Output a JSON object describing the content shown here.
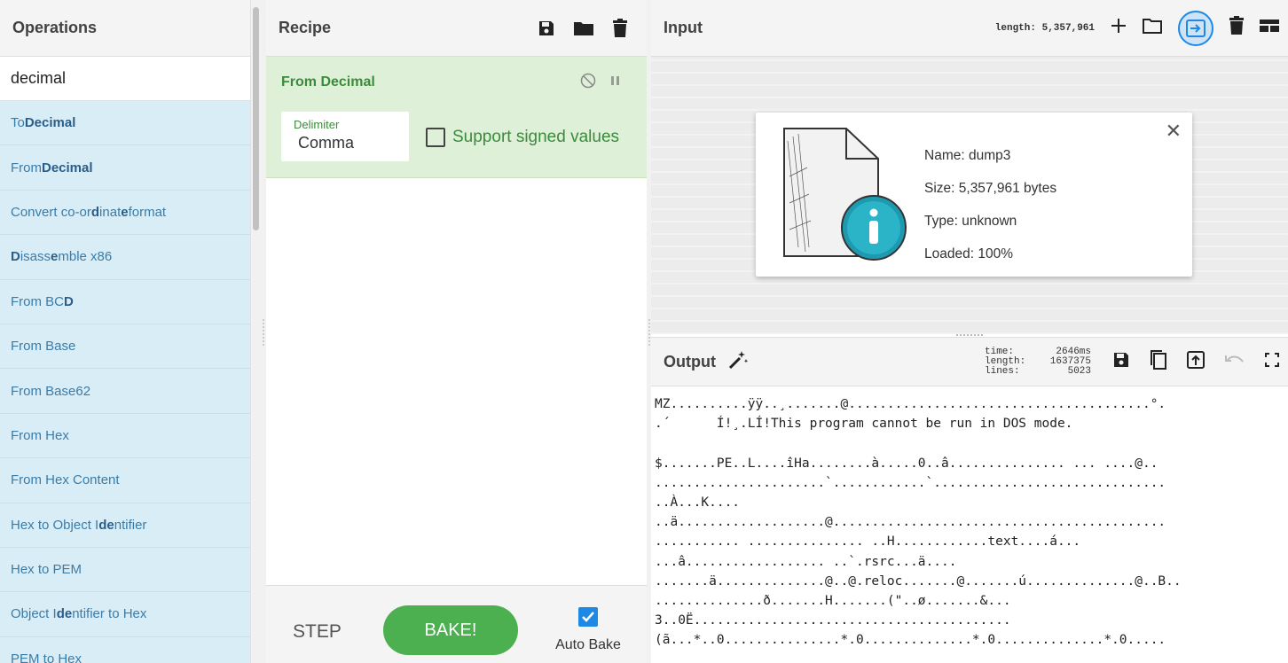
{
  "operations": {
    "title": "Operations",
    "search_value": "decimal",
    "items": [
      {
        "pre": "To ",
        "hl": "Decimal",
        "post": ""
      },
      {
        "pre": "From ",
        "hl": "Decimal",
        "post": ""
      },
      {
        "pre": "Convert co-or",
        "hl": "d",
        "mid": "inat",
        "hl2": "e",
        "post": " format"
      },
      {
        "pre": "",
        "hl": "D",
        "mid": "isass",
        "hl2": "e",
        "post": "mble x86"
      },
      {
        "pre": "From BC",
        "hl": "D",
        "post": ""
      },
      {
        "pre": "From Base",
        "hl": "",
        "post": ""
      },
      {
        "pre": "From Base62",
        "hl": "",
        "post": ""
      },
      {
        "pre": "From Hex",
        "hl": "",
        "post": ""
      },
      {
        "pre": "From Hex Content",
        "hl": "",
        "post": ""
      },
      {
        "pre": "Hex to Object I",
        "hl": "de",
        "post": "ntifier"
      },
      {
        "pre": "Hex to PEM",
        "hl": "",
        "post": ""
      },
      {
        "pre": "Object I",
        "hl": "de",
        "post": "ntifier to Hex"
      },
      {
        "pre": "PEM to Hex",
        "hl": "",
        "post": ""
      }
    ]
  },
  "recipe": {
    "title": "Recipe",
    "operation": {
      "name": "From Decimal",
      "delimiter_label": "Delimiter",
      "delimiter_value": "Comma",
      "signed_label": "Support signed values",
      "signed_checked": false
    },
    "step_label": "STEP",
    "bake_label": "BAKE!",
    "autobake_label": "Auto Bake",
    "autobake_checked": true
  },
  "input": {
    "title": "Input",
    "length_text": "length: 5,357,961",
    "file": {
      "name": "Name: dump3",
      "size": "Size: 5,357,961 bytes",
      "type": "Type: unknown",
      "loaded": "Loaded: 100%",
      "close": "✕"
    }
  },
  "output": {
    "title": "Output",
    "time_label": "time:",
    "time_value": "2646ms",
    "length_label": "length:",
    "length_value": "1637375",
    "lines_label": "lines:",
    "lines_value": "5023",
    "lines": [
      "MZ..........ÿÿ..¸.......@.......................................°.",
      ".´      Í!¸.LÍ!This program cannot be run in DOS mode.",
      "",
      "$.......PE..L....îHa........à.....0..â............... ... ....@..",
      "......................`............`..............................",
      "..À...K....",
      "..ä...................@...........................................",
      "........... ............... ..H............text....á...",
      "...â.................. ..`.rsrc...ä....",
      ".......ä..............@..@.reloc.......@.......ú..............@..B..",
      "..............ð.......H.......(\"..ø.......&...",
      "3..0Ë.........................................",
      "(ã...*..0...............*.0..............*.0..............*.0....."
    ]
  },
  "colors": {
    "op_bg": "#d9edf7",
    "op_text": "#3a7ca8",
    "recipe_green": "#dff0d8",
    "bake_green": "#4caf50",
    "accent_blue": "#1e88e5"
  }
}
